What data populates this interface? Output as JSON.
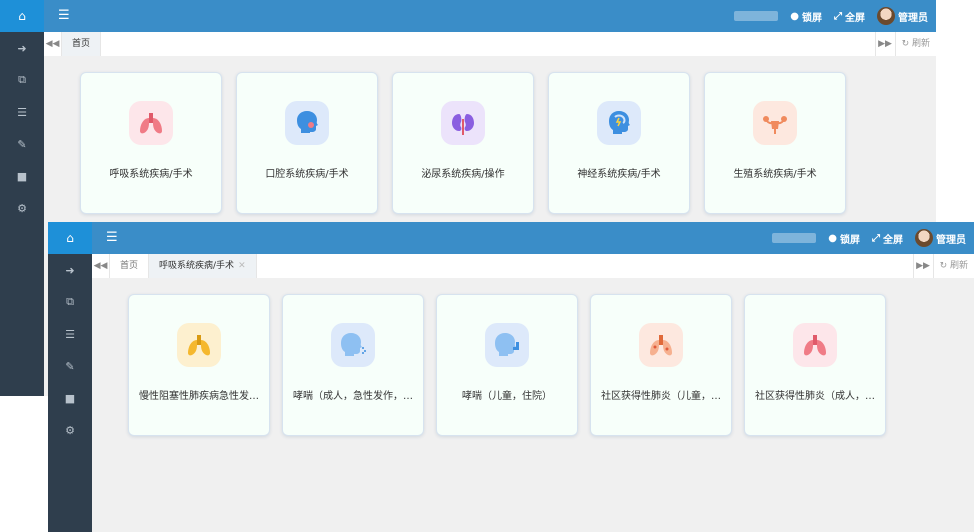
{
  "front": {
    "tabs": [
      "首页",
      "呼吸系统疾病/手术"
    ],
    "header": {
      "lock_label": "锁屏",
      "fullscreen_label": "全屏",
      "user_label": "管理员",
      "refresh_label": "刷新"
    },
    "cards": [
      {
        "label": "慢性阻塞性肺疾病急性发…",
        "icon": "lungs-icon",
        "color": "#f5b82e"
      },
      {
        "label": "哮喘（成人，急性发作，…",
        "icon": "cough-head-icon",
        "color": "#3d8fe0"
      },
      {
        "label": "哮喘（儿童，住院）",
        "icon": "inhaler-head-icon",
        "color": "#3d8fe0"
      },
      {
        "label": "社区获得性肺炎（儿童，…",
        "icon": "infected-lungs-icon",
        "color": "#f08a5d"
      },
      {
        "label": "社区获得性肺炎（成人，…",
        "icon": "lungs-icon",
        "color": "#f07b86"
      }
    ]
  },
  "back": {
    "tabs": [
      "首页"
    ],
    "header": {
      "lock_label": "锁屏",
      "fullscreen_label": "全屏",
      "user_label": "管理员",
      "refresh_label": "刷新"
    },
    "cards": [
      {
        "label": "呼吸系统疾病/手术",
        "icon": "lungs-icon",
        "color": "#f07b86"
      },
      {
        "label": "口腔系统疾病/手术",
        "icon": "mouth-head-icon",
        "color": "#3d8fe0"
      },
      {
        "label": "泌尿系统疾病/操作",
        "icon": "kidney-icon",
        "color": "#8a5ee0"
      },
      {
        "label": "神经系统疾病/手术",
        "icon": "brain-head-icon",
        "color": "#3d8fe0"
      },
      {
        "label": "生殖系统疾病/手术",
        "icon": "uterus-icon",
        "color": "#f08a5d"
      }
    ]
  },
  "sidebar_icons": [
    "home-icon",
    "sign-in-icon",
    "external-link-icon",
    "database-icon",
    "edit-icon",
    "video-icon",
    "gear-icon"
  ]
}
